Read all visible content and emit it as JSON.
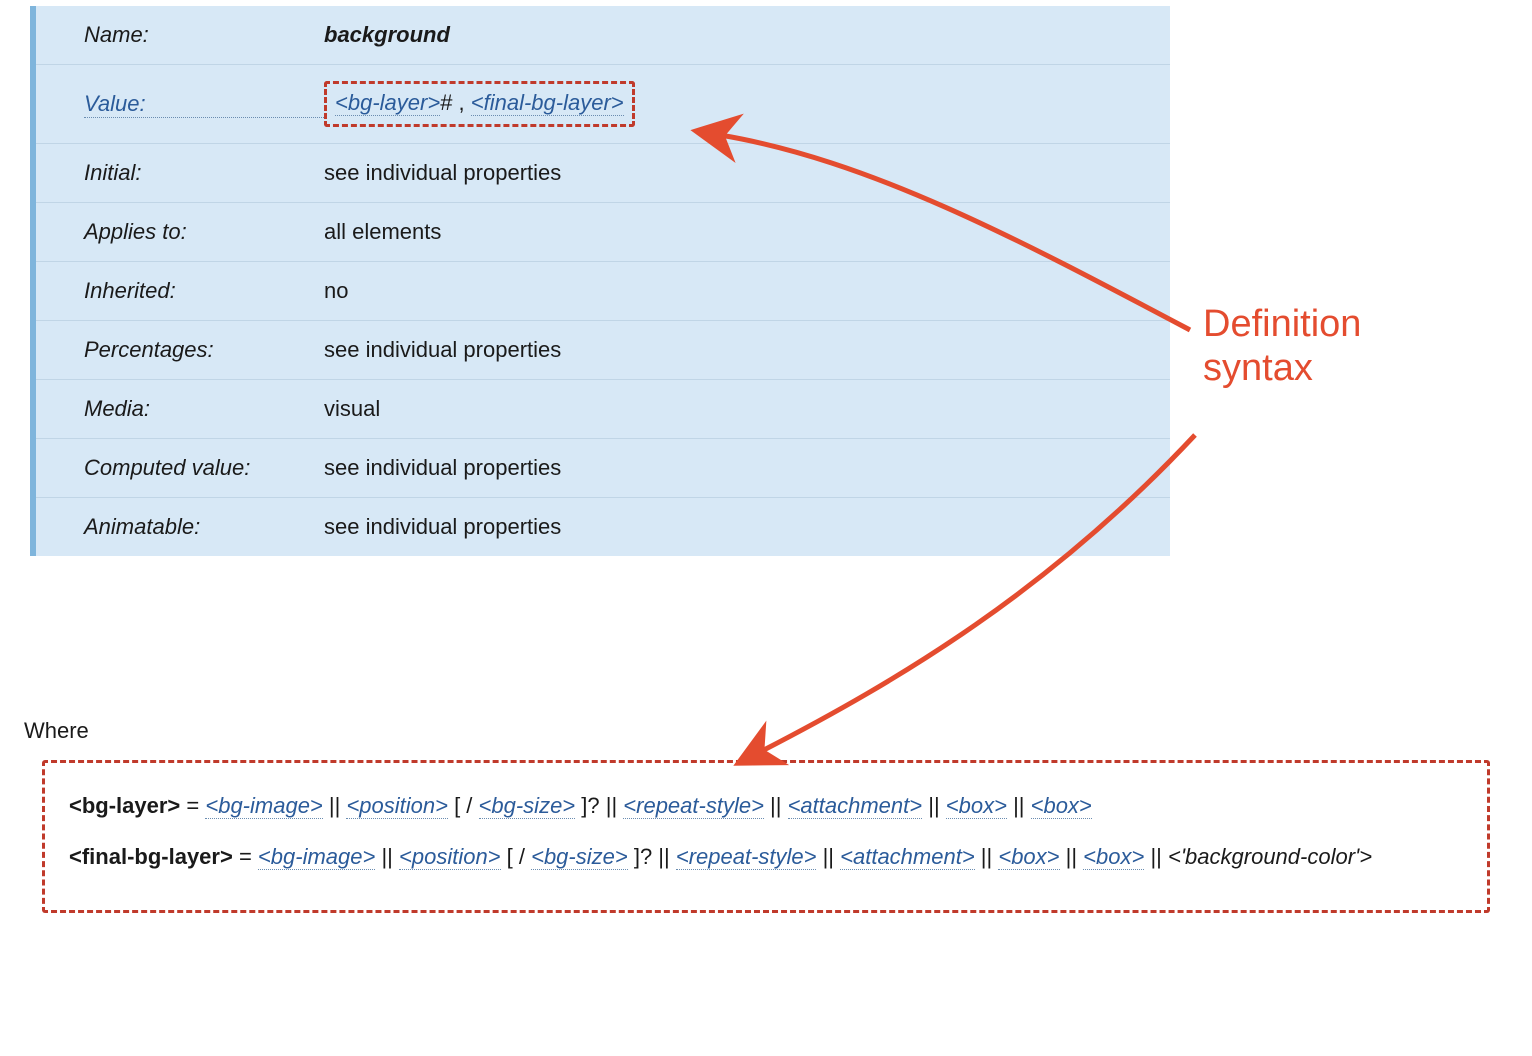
{
  "annotation": {
    "label": "Definition\nsyntax"
  },
  "propdef": {
    "rows": [
      {
        "label": "Name:",
        "label_link": false,
        "value": {
          "type": "name",
          "text": "background"
        }
      },
      {
        "label": "Value:",
        "label_link": true,
        "value": {
          "type": "syntax",
          "parts": [
            {
              "kind": "link",
              "text": "<bg-layer>"
            },
            {
              "kind": "text",
              "text": "# , "
            },
            {
              "kind": "link",
              "text": "<final-bg-layer>"
            }
          ]
        }
      },
      {
        "label": "Initial:",
        "label_link": false,
        "value": {
          "type": "text",
          "text": "see individual properties"
        }
      },
      {
        "label": "Applies to:",
        "label_link": false,
        "value": {
          "type": "text",
          "text": "all elements"
        }
      },
      {
        "label": "Inherited:",
        "label_link": false,
        "value": {
          "type": "text",
          "text": "no"
        }
      },
      {
        "label": "Percentages:",
        "label_link": false,
        "value": {
          "type": "text",
          "text": "see individual properties"
        }
      },
      {
        "label": "Media:",
        "label_link": false,
        "value": {
          "type": "text",
          "text": "visual"
        }
      },
      {
        "label": "Computed value:",
        "label_link": false,
        "value": {
          "type": "text",
          "text": "see individual properties"
        }
      },
      {
        "label": "Animatable:",
        "label_link": false,
        "value": {
          "type": "text",
          "text": "see individual properties"
        }
      }
    ]
  },
  "where": {
    "heading": "Where",
    "defs": [
      {
        "name": "<bg-layer>",
        "rhs": [
          {
            "kind": "text",
            "text": " = "
          },
          {
            "kind": "link",
            "text": "<bg-image>"
          },
          {
            "kind": "text",
            "text": " || "
          },
          {
            "kind": "link",
            "text": "<position>"
          },
          {
            "kind": "text",
            "text": " [ / "
          },
          {
            "kind": "link",
            "text": "<bg-size>"
          },
          {
            "kind": "text",
            "text": " ]? || "
          },
          {
            "kind": "link",
            "text": "<repeat-style>"
          },
          {
            "kind": "text",
            "text": " || "
          },
          {
            "kind": "link",
            "text": "<attachment>"
          },
          {
            "kind": "text",
            "text": " || "
          },
          {
            "kind": "link",
            "text": "<box>"
          },
          {
            "kind": "text",
            "text": " || "
          },
          {
            "kind": "link",
            "text": "<box>"
          }
        ]
      },
      {
        "name": "<final-bg-layer>",
        "rhs": [
          {
            "kind": "text",
            "text": " = "
          },
          {
            "kind": "link",
            "text": "<bg-image>"
          },
          {
            "kind": "text",
            "text": " || "
          },
          {
            "kind": "link",
            "text": "<position>"
          },
          {
            "kind": "text",
            "text": " [ / "
          },
          {
            "kind": "link",
            "text": "<bg-size>"
          },
          {
            "kind": "text",
            "text": " ]? || "
          },
          {
            "kind": "link",
            "text": "<repeat-style>"
          },
          {
            "kind": "text",
            "text": " || "
          },
          {
            "kind": "link",
            "text": "<attachment>"
          },
          {
            "kind": "text",
            "text": " || "
          },
          {
            "kind": "link",
            "text": "<box>"
          },
          {
            "kind": "text",
            "text": " || "
          },
          {
            "kind": "link",
            "text": "<box>"
          },
          {
            "kind": "text",
            "text": " || "
          },
          {
            "kind": "italic",
            "text": "<'background-color'>"
          }
        ]
      }
    ]
  }
}
